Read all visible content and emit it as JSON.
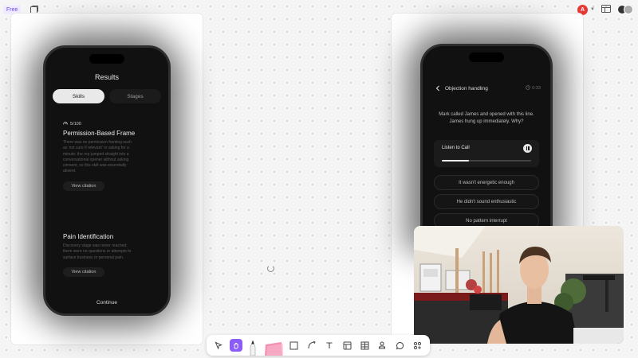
{
  "topbar": {
    "plan_badge": "Free",
    "frame_icon": "frame-icon",
    "avatar_initial": "A",
    "layout_icon": "layout-icon"
  },
  "left_phone": {
    "title": "Results",
    "tabs": [
      {
        "label": "Skills",
        "active": true
      },
      {
        "label": "Stages",
        "active": false
      }
    ],
    "items": [
      {
        "score": "5/100",
        "title": "Permission-Based Frame",
        "description": "There was no permission framing such as 'not sure if relevant' or asking for a minute; the rep jumped straight into a conversational opener without asking consent, so this skill was essentially absent.",
        "button": "View citation"
      },
      {
        "title": "Pain Identification",
        "description": "Discovery stage was never reached; there were no questions or attempts to surface business or personal pain.",
        "button": "View citation"
      }
    ],
    "continue_label": "Continue"
  },
  "right_phone": {
    "header_title": "Objection handling",
    "timer": "0:33",
    "question": "Mark called James and opened with this line. James hung up immediately. Why?",
    "listen_label": "Listen to Call",
    "progress": 0.3,
    "options": [
      "It wasn't energetic enough",
      "He didn't sound enthusiastic",
      "No pattern interrupt"
    ]
  },
  "colors": {
    "accent": "#8b5cf6",
    "avatar_red": "#e53935",
    "canvas_bg": "#f5f5f5"
  },
  "toolbar": {
    "tools": [
      "select-tool-icon",
      "hand-tool-icon",
      "pen-tool-icon",
      "sticky-note-icon",
      "shape-tool-icon",
      "connector-icon",
      "text-tool-icon",
      "frame-tool-icon",
      "table-tool-icon",
      "stamp-icon",
      "comment-icon",
      "more-tools-icon"
    ],
    "active_tool": "hand-tool-icon"
  }
}
